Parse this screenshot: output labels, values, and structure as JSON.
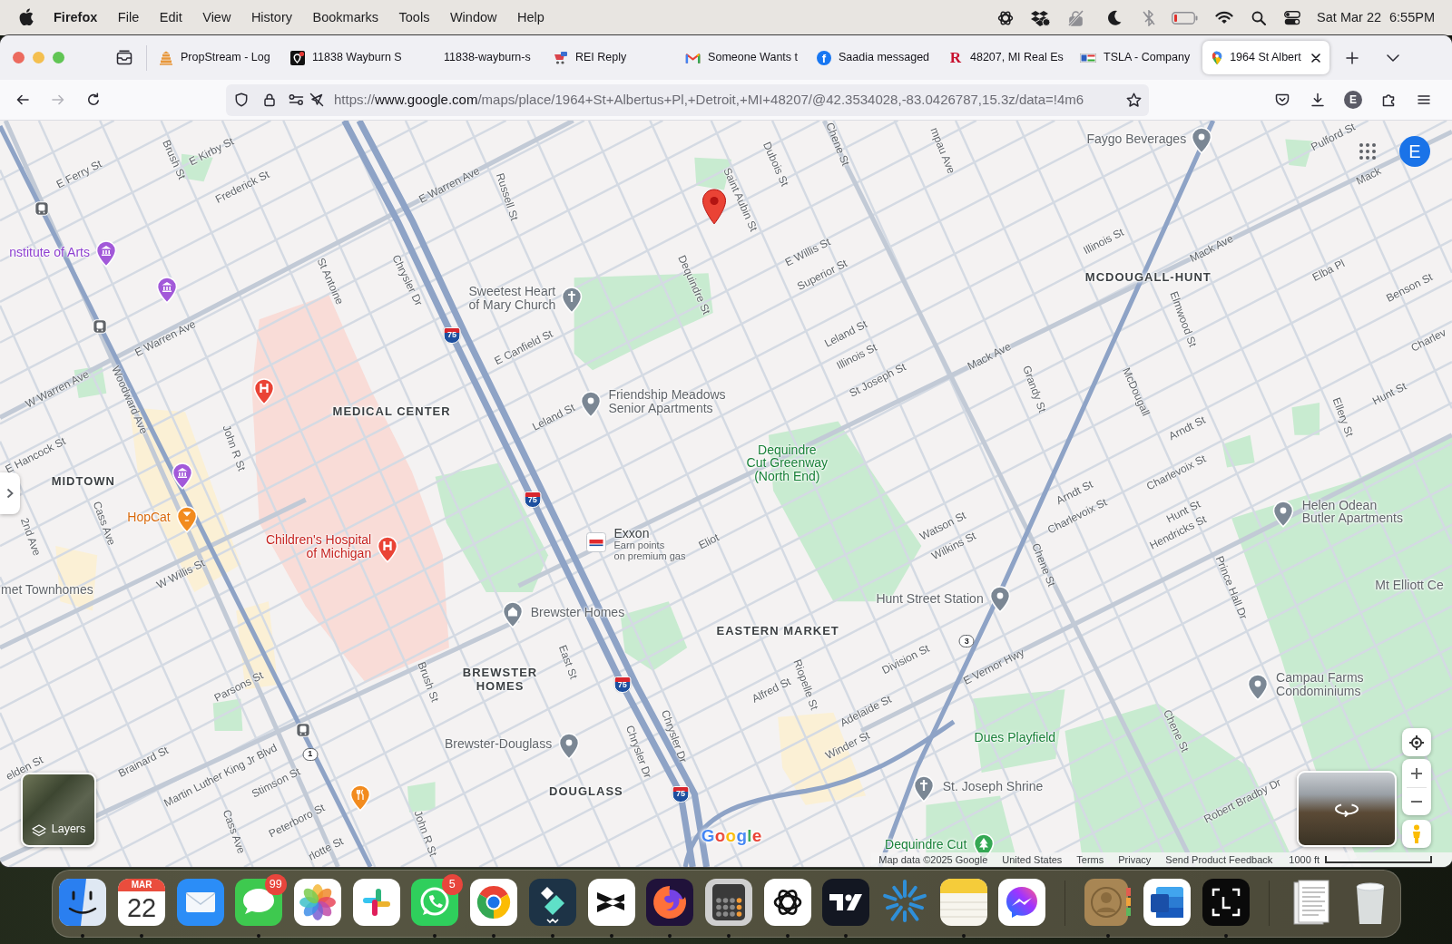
{
  "menubar": {
    "app": "Firefox",
    "menus": [
      "File",
      "Edit",
      "View",
      "History",
      "Bookmarks",
      "Tools",
      "Window",
      "Help"
    ],
    "date": "Sat Mar 22",
    "time": "6:55PM"
  },
  "tabs": [
    {
      "title": "PropStream - Log",
      "kind": "stack",
      "selected": false
    },
    {
      "title": "11838 Wayburn S",
      "kind": "pin",
      "selected": false
    },
    {
      "title": "11838-wayburn-s",
      "kind": "none",
      "selected": false
    },
    {
      "title": "REI Reply",
      "kind": "rei",
      "selected": false
    },
    {
      "title": "Someone Wants t",
      "kind": "mail",
      "selected": false
    },
    {
      "title": "Saadia messaged",
      "kind": "facebook",
      "icon_text": "f",
      "selected": false
    },
    {
      "title": "48207, MI Real Es",
      "kind": "letter",
      "icon_text": "R",
      "selected": false
    },
    {
      "title": "TSLA - Company",
      "kind": "flag",
      "selected": false
    },
    {
      "title": "1964 St Albert",
      "kind": "maps",
      "selected": true
    }
  ],
  "toolbar": {
    "buttons": [
      {
        "kind": "back",
        "disabled": false
      },
      {
        "kind": "forward",
        "disabled": true
      },
      {
        "kind": "reload",
        "disabled": false
      }
    ],
    "address": {
      "scheme": "https://",
      "host": "www.google.com",
      "path": "/maps/place/1964+St+Albertus+Pl,+Detroit,+MI+48207/@42.3534028,-83.0426787,15.3z/data=!4m6"
    },
    "profile_initial": "E"
  },
  "map": {
    "account_initial": "E",
    "streets": [
      "E Ferry St",
      "Brush St",
      "E Kirby St",
      "Frederick St",
      "E Warren Ave",
      "Russell St",
      "Dubois St",
      "Chene St",
      "mpau Ave",
      "Saint Aubin St",
      "Pulford St",
      "Mack",
      "E Willis St",
      "Superior St",
      "Illinois St",
      "Mack Ave",
      "Elba Pl",
      "Benson St",
      "Charlev",
      "St Antoine",
      "Chrysler Dr",
      "Dequindre St",
      "Elmwood St",
      "E Canfield St",
      "Leland St",
      "Illinois St",
      "St Joseph St",
      "Mack Ave",
      "Grandy St",
      "McDougall",
      "Hunt St",
      "Ellery St",
      "Arndt St",
      "Charlevoix St",
      "E Warren Ave",
      "W Warren Ave",
      "Woodward Ave",
      "John R St",
      "E Hancock St",
      "Leland St",
      "Cass Ave",
      "2nd Ave",
      "Arndt St",
      "Charlevoix St",
      "Hunt St",
      "Hendricks St",
      "Eliot",
      "Watson St",
      "Wilkins St",
      "W Willis St",
      "Chene St",
      "Prince Hall Dr",
      "Division St",
      "E Vernor Hwy",
      "East St",
      "Brush St",
      "Parsons St",
      "Riopelle St",
      "Alfred St",
      "Adelaide St",
      "Chene St",
      "Chrysler Dr",
      "Chrysler Dr",
      "Winder St",
      "Brainard St",
      "elden St",
      "Martin Luther King Jr Blvd",
      "Stimson St",
      "Robert Bradby Dr",
      "Peterboro St",
      "Cass Ave",
      "John R St",
      "rlotte St"
    ],
    "areas": [
      {
        "lines": [
          "MCDOUGALL-HUNT"
        ]
      },
      {
        "lines": [
          "MEDICAL CENTER"
        ]
      },
      {
        "lines": [
          "MIDTOWN"
        ]
      },
      {
        "lines": [
          "EASTERN MARKET"
        ]
      },
      {
        "lines": [
          "BREWSTER",
          "HOMES"
        ]
      },
      {
        "lines": [
          "DOUGLASS"
        ]
      }
    ],
    "places": [
      {
        "lines": [
          "Faygo Beverages"
        ],
        "kind": "place"
      },
      {
        "lines": [
          "nstitute of Arts"
        ],
        "kind": "museum"
      },
      {
        "lines": [
          "Sweetest Heart",
          "of Mary Church"
        ],
        "kind": "church"
      },
      {
        "lines": [
          "Friendship Meadows",
          "Senior Apartments"
        ],
        "kind": "place"
      },
      {
        "lines": [
          "Dequindre",
          "Cut Greenway",
          "(North End)"
        ],
        "kind": "park_label"
      },
      {
        "lines": [
          "HopCat"
        ],
        "kind": "bar"
      },
      {
        "lines": [
          "Helen Odean",
          "Butler Apartments"
        ],
        "kind": "place"
      },
      {
        "lines": [
          "Children's Hospital",
          "of Michigan"
        ],
        "kind": "hospital"
      },
      {
        "lines": [
          "Exxon"
        ],
        "note": [
          "Earn points",
          "on premium gas"
        ],
        "kind": "gas"
      },
      {
        "lines": [
          "met Townhomes"
        ],
        "kind": "label"
      },
      {
        "lines": [
          "Hunt Street Station"
        ],
        "kind": "place"
      },
      {
        "lines": [
          "Mt Elliott Ce"
        ],
        "kind": "label"
      },
      {
        "lines": [
          "Brewster Homes"
        ],
        "kind": "housing"
      },
      {
        "lines": [
          "Campau Farms",
          "Condominiums"
        ],
        "kind": "place"
      },
      {
        "lines": [
          "Brewster-Douglass"
        ],
        "kind": "place"
      },
      {
        "lines": [
          "Dues Playfield"
        ],
        "kind": "park_label"
      },
      {
        "lines": [
          "St. Joseph Shrine"
        ],
        "kind": "church"
      },
      {
        "lines": [
          "Dequindre Cut"
        ],
        "kind": "park"
      }
    ],
    "markers": [
      {
        "kind": "transit"
      },
      {
        "kind": "museum"
      },
      {
        "kind": "transit"
      },
      {
        "kind": "hospital"
      },
      {
        "kind": "museum"
      },
      {
        "kind": "transit"
      },
      {
        "kind": "restaurant"
      }
    ],
    "shields": [
      {
        "kind": "interstate",
        "number": "75"
      },
      {
        "kind": "interstate",
        "number": "75"
      },
      {
        "kind": "state",
        "number": "3"
      },
      {
        "kind": "interstate",
        "number": "75"
      },
      {
        "kind": "state",
        "number": "1"
      },
      {
        "kind": "interstate",
        "number": "75"
      }
    ],
    "layers_label": "Layers",
    "logo": "Google",
    "footer": [
      "Map data ©2025 Google",
      "United States",
      "Terms",
      "Privacy",
      "Send Product Feedback"
    ],
    "scale": "1000 ft"
  },
  "dock": [
    {
      "kind": "finder",
      "running": true
    },
    {
      "kind": "calendar",
      "month": "MAR",
      "day": "22",
      "running": true
    },
    {
      "kind": "mail",
      "running": false
    },
    {
      "kind": "messages",
      "badge": "99",
      "running": true
    },
    {
      "kind": "photos",
      "running": false
    },
    {
      "kind": "slack",
      "running": false
    },
    {
      "kind": "whatsapp",
      "badge": "5",
      "running": true
    },
    {
      "kind": "chrome",
      "running": true
    },
    {
      "kind": "filmora",
      "running": true
    },
    {
      "kind": "capcut",
      "running": true
    },
    {
      "kind": "firefox",
      "running": true
    },
    {
      "kind": "calculator",
      "running": true
    },
    {
      "kind": "chatgpt",
      "running": true
    },
    {
      "kind": "tradingview",
      "running": true
    },
    {
      "kind": "spark",
      "running": false
    },
    {
      "kind": "notes",
      "running": true
    },
    {
      "kind": "messenger",
      "running": false
    },
    {
      "kind": "separator"
    },
    {
      "kind": "contacts",
      "running": true
    },
    {
      "kind": "word",
      "running": false
    },
    {
      "kind": "screenshot",
      "running": true
    },
    {
      "kind": "separator"
    },
    {
      "kind": "documents",
      "running": false
    },
    {
      "kind": "trash",
      "running": false
    }
  ]
}
